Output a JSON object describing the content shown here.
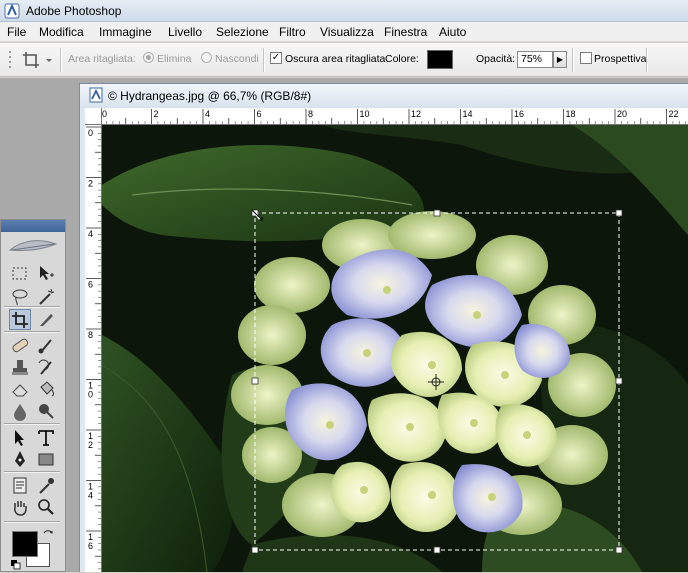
{
  "app": {
    "title": "Adobe Photoshop"
  },
  "menu": [
    "File",
    "Modifica",
    "Immagine",
    "Livello",
    "Selezione",
    "Filtro",
    "Visualizza",
    "Finestra",
    "Aiuto"
  ],
  "options": {
    "area_label": "Area ritagliata:",
    "delete_label": "Elimina",
    "hide_label": "Nascondi",
    "shield_label": "Oscura area ritagliata",
    "shield_checked": true,
    "color_label": "Colore:",
    "color_value": "#000000",
    "opacity_label": "Opacità:",
    "opacity_value": "75%",
    "perspective_label": "Prospettiva",
    "perspective_checked": false
  },
  "document": {
    "title": "© Hydrangeas.jpg @ 66,7% (RGB/8#)"
  },
  "ruler_top_labels": [
    "0",
    "2",
    "4",
    "6",
    "8",
    "10",
    "12",
    "14",
    "16",
    "18",
    "20",
    "22"
  ],
  "ruler_left_labels": [
    "0",
    "2",
    "4",
    "6",
    "8",
    "10",
    "12",
    "14",
    "16"
  ],
  "toolbox": {
    "tools": [
      {
        "name": "marquee-tool",
        "icon": "dotted-rect"
      },
      {
        "name": "move-tool",
        "icon": "move-arrow"
      },
      {
        "name": "lasso-tool",
        "icon": "lasso"
      },
      {
        "name": "magic-wand-tool",
        "icon": "wand"
      },
      {
        "name": "crop-tool",
        "icon": "crop",
        "active": true
      },
      {
        "name": "slice-tool",
        "icon": "knife"
      },
      {
        "name": "healing-brush-tool",
        "icon": "bandage"
      },
      {
        "name": "brush-tool",
        "icon": "brush"
      },
      {
        "name": "clone-stamp-tool",
        "icon": "stamp"
      },
      {
        "name": "history-brush-tool",
        "icon": "history-brush"
      },
      {
        "name": "eraser-tool",
        "icon": "eraser"
      },
      {
        "name": "paint-bucket-tool",
        "icon": "bucket"
      },
      {
        "name": "blur-tool",
        "icon": "drop"
      },
      {
        "name": "dodge-tool",
        "icon": "dodge"
      },
      {
        "name": "path-selection-tool",
        "icon": "arrow"
      },
      {
        "name": "type-tool",
        "icon": "T"
      },
      {
        "name": "pen-tool",
        "icon": "pen"
      },
      {
        "name": "shape-tool",
        "icon": "rectangle"
      },
      {
        "name": "notes-tool",
        "icon": "note"
      },
      {
        "name": "eyedropper-tool",
        "icon": "eyedropper"
      },
      {
        "name": "hand-tool",
        "icon": "hand"
      },
      {
        "name": "zoom-tool",
        "icon": "magnifier"
      }
    ],
    "foreground_color": "#000000",
    "background_color": "#ffffff"
  }
}
